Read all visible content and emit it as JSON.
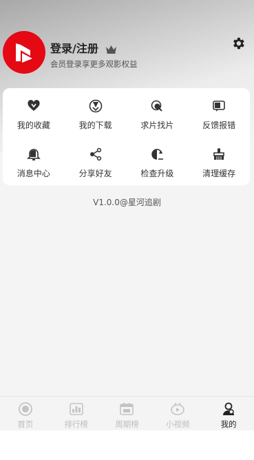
{
  "colors": {
    "brand_red": "#e50914",
    "accent_dark": "#222222",
    "inactive": "#bdbdbd"
  },
  "profile": {
    "avatar_icon": "play-logo-icon",
    "login_label": "登录/注册",
    "login_subtitle": "会员登录享更多观影权益",
    "vip_icon": "crown-icon",
    "settings_icon": "gear-icon"
  },
  "menu": {
    "items": [
      {
        "label": "我的收藏",
        "icon": "heart-icon"
      },
      {
        "label": "我的下载",
        "icon": "download-icon"
      },
      {
        "label": "求片找片",
        "icon": "search-film-icon"
      },
      {
        "label": "反馈报错",
        "icon": "feedback-icon"
      },
      {
        "label": "消息中心",
        "icon": "bell-icon"
      },
      {
        "label": "分享好友",
        "icon": "share-icon"
      },
      {
        "label": "检查升级",
        "icon": "update-icon"
      },
      {
        "label": "清理缓存",
        "icon": "broom-icon"
      }
    ]
  },
  "version_text": "V1.0.0@星河追剧",
  "tabbar": {
    "tabs": [
      {
        "label": "首页",
        "icon": "home-icon",
        "active": false
      },
      {
        "label": "排行榜",
        "icon": "ranking-icon",
        "active": false
      },
      {
        "label": "周期榜",
        "icon": "calendar-icon",
        "active": false
      },
      {
        "label": "小视频",
        "icon": "short-video-icon",
        "active": false
      },
      {
        "label": "我的",
        "icon": "profile-icon",
        "active": true
      }
    ]
  }
}
